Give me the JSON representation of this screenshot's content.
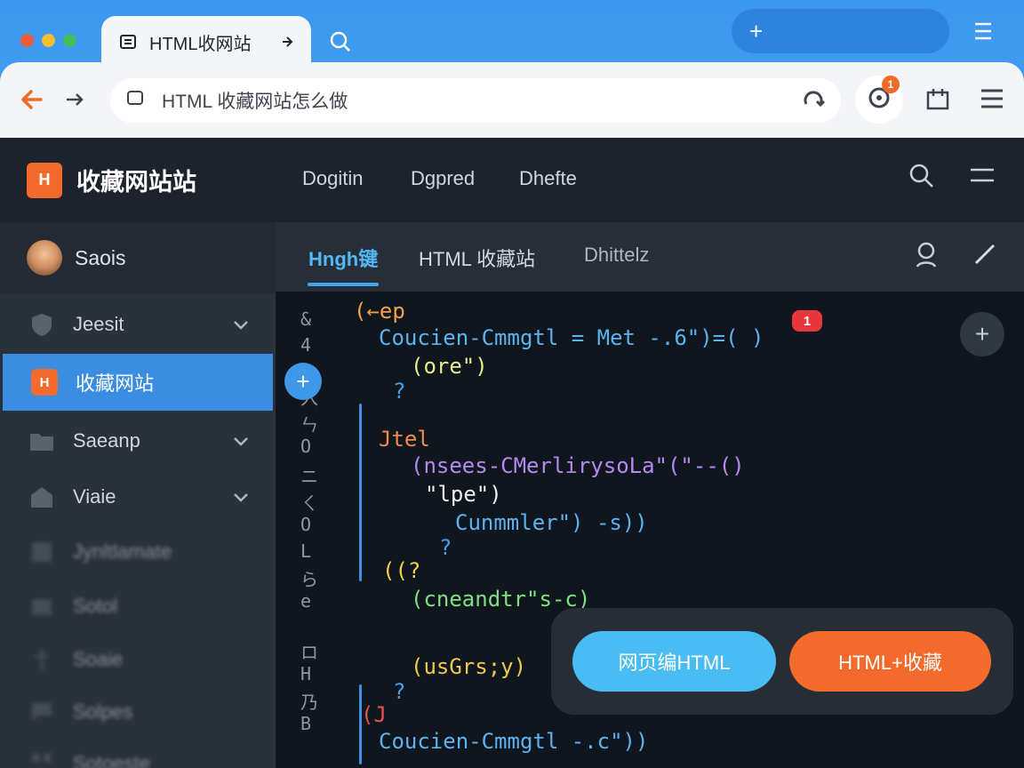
{
  "browser": {
    "tab_title": "HTML收网站",
    "url_text": "HTML 收藏网站怎么做",
    "extension_badge": "1"
  },
  "app": {
    "brand_logo": "H",
    "brand_name": "收藏网站站",
    "nav": [
      "Dogitin",
      "Dgpred",
      "Dhefte"
    ],
    "user_name": "Saois",
    "sidebar": [
      {
        "label": "Jeesit",
        "icon": "shield-icon",
        "chevron": true
      },
      {
        "label": "收藏网站",
        "icon": "html-logo-icon",
        "active": true
      },
      {
        "label": "Saeanp",
        "icon": "folder-icon",
        "chevron": true
      },
      {
        "label": "Viaie",
        "icon": "home-icon",
        "chevron": true
      },
      {
        "label": "Jynltlamate",
        "icon": "doc-icon"
      },
      {
        "label": "Sotol",
        "icon": "box-icon"
      },
      {
        "label": "Soaie",
        "icon": "pin-icon"
      },
      {
        "label": "Solpes",
        "icon": "chat-icon"
      },
      {
        "label": "Sotoeste",
        "icon": "grid-icon"
      }
    ],
    "tabs": [
      "Hngh键",
      "HTML 收藏站",
      "Dhittelz"
    ]
  },
  "code": {
    "badge": "1",
    "gutter": [
      "&",
      "4",
      "",
      "入",
      "ㄣ",
      "O",
      "ニ",
      "ㄑ",
      "O",
      "L",
      "ら",
      "e",
      "",
      "ロ",
      "H",
      "乃",
      "B"
    ],
    "lines": [
      "(←ep",
      "Coucien-Cmmgtl = Met -.6\")=( )",
      "(ore\")",
      "?",
      "Jtel",
      "(nsees-CMerlirysoLa\"(\"--()",
      "\"lpe\")",
      "Cunmmler\") -s))",
      "?",
      "((?",
      "(cneandtr\"s-c)",
      "(usGrs;y)",
      "?",
      "(J",
      "Coucien-Cmmgtl -.c\"))"
    ]
  },
  "actions": {
    "primary": "网页编HTML",
    "secondary": "HTML+收藏"
  },
  "colors": {
    "chrome_blue": "#3f9bee",
    "accent_orange": "#f46a2c",
    "accent_blue": "#49bcf4",
    "sidebar_active": "#3a8de0"
  }
}
